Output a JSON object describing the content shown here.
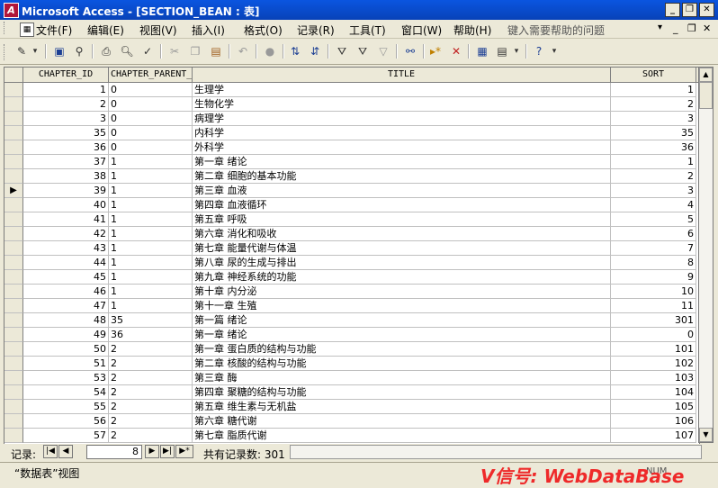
{
  "window": {
    "title": "Microsoft Access - [SECTION_BEAN : 表]",
    "app_icon": "access-icon"
  },
  "menu": {
    "items": [
      "文件(F)",
      "编辑(E)",
      "视图(V)",
      "插入(I)",
      "格式(O)",
      "记录(R)",
      "工具(T)",
      "窗口(W)",
      "帮助(H)"
    ],
    "help_placeholder": "键入需要帮助的问题"
  },
  "toolbar": {
    "icons": [
      "view-icon",
      "save-icon",
      "search-db-icon",
      "print-icon",
      "print-preview-icon",
      "spelling-icon",
      "cut-icon",
      "copy-icon",
      "paste-icon",
      "undo-icon",
      "hyperlink-icon",
      "sort-asc-icon",
      "sort-desc-icon",
      "filter-selection-icon",
      "filter-form-icon",
      "apply-filter-icon",
      "find-icon",
      "new-record-icon",
      "delete-record-icon",
      "database-window-icon",
      "new-object-icon",
      "help-icon"
    ]
  },
  "table": {
    "columns": [
      "CHAPTER_ID",
      "CHAPTER_PARENT_",
      "TITLE",
      "SORT"
    ],
    "current_row": 7,
    "rows": [
      [
        "1",
        "0",
        "生理学",
        "1"
      ],
      [
        "2",
        "0",
        "生物化学",
        "2"
      ],
      [
        "3",
        "0",
        "病理学",
        "3"
      ],
      [
        "35",
        "0",
        "内科学",
        "35"
      ],
      [
        "36",
        "0",
        "外科学",
        "36"
      ],
      [
        "37",
        "1",
        "第一章   绪论",
        "1"
      ],
      [
        "38",
        "1",
        "第二章   细胞的基本功能",
        "2"
      ],
      [
        "39",
        "1",
        "第三章   血液",
        "3"
      ],
      [
        "40",
        "1",
        "第四章   血液循环",
        "4"
      ],
      [
        "41",
        "1",
        "第五章   呼吸",
        "5"
      ],
      [
        "42",
        "1",
        "第六章   消化和吸收",
        "6"
      ],
      [
        "43",
        "1",
        "第七章   能量代谢与体温",
        "7"
      ],
      [
        "44",
        "1",
        "第八章   尿的生成与排出",
        "8"
      ],
      [
        "45",
        "1",
        "第九章   神经系统的功能",
        "9"
      ],
      [
        "46",
        "1",
        "第十章   内分泌",
        "10"
      ],
      [
        "47",
        "1",
        "第十一章   生殖",
        "11"
      ],
      [
        "48",
        "35",
        "第一篇 绪论",
        "301"
      ],
      [
        "49",
        "36",
        "第一章 绪论",
        "0"
      ],
      [
        "50",
        "2",
        "第一章   蛋白质的结构与功能",
        "101"
      ],
      [
        "51",
        "2",
        "第二章   核酸的结构与功能",
        "102"
      ],
      [
        "53",
        "2",
        "第三章 酶",
        "103"
      ],
      [
        "54",
        "2",
        "第四章 聚糖的结构与功能",
        "104"
      ],
      [
        "55",
        "2",
        "第五章 维生素与无机盐",
        "105"
      ],
      [
        "56",
        "2",
        "第六章 糖代谢",
        "106"
      ],
      [
        "57",
        "2",
        "第七章 脂质代谢",
        "107"
      ]
    ]
  },
  "navigation": {
    "label": "记录:",
    "current": "8",
    "total_text": "共有记录数: 301"
  },
  "status": {
    "view": "“数据表”视图",
    "indicator": "NUM"
  },
  "watermark": "V信号: WebDataBase"
}
